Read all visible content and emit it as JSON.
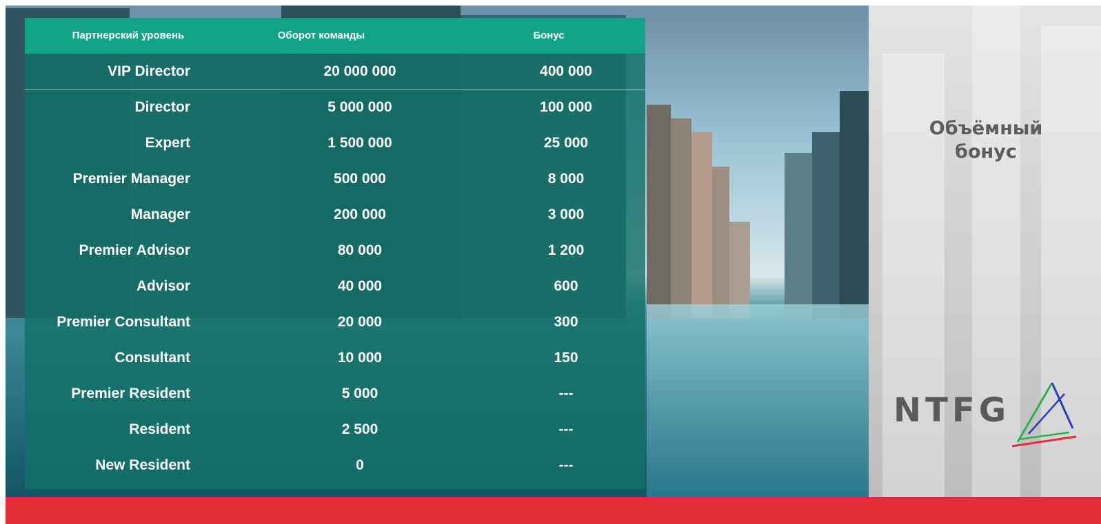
{
  "table": {
    "headers": [
      "Партнерский уровень",
      "Оборот команды",
      "Бонус"
    ],
    "rows": [
      {
        "level": "VIP Director",
        "turnover": "20 000 000",
        "bonus": "400 000"
      },
      {
        "level": "Director",
        "turnover": "5 000 000",
        "bonus": "100 000"
      },
      {
        "level": "Expert",
        "turnover": "1 500 000",
        "bonus": "25 000"
      },
      {
        "level": "Premier Manager",
        "turnover": "500 000",
        "bonus": "8 000"
      },
      {
        "level": "Manager",
        "turnover": "200 000",
        "bonus": "3 000"
      },
      {
        "level": "Premier Advisor",
        "turnover": "80 000",
        "bonus": "1 200"
      },
      {
        "level": "Advisor",
        "turnover": "40 000",
        "bonus": "600"
      },
      {
        "level": "Premier Consultant",
        "turnover": "20 000",
        "bonus": "300"
      },
      {
        "level": "Consultant",
        "turnover": "10 000",
        "bonus": "150"
      },
      {
        "level": "Premier Resident",
        "turnover": "5 000",
        "bonus": "---"
      },
      {
        "level": "Resident",
        "turnover": "2 500",
        "bonus": "---"
      },
      {
        "level": "New Resident",
        "turnover": "0",
        "bonus": "---"
      }
    ]
  },
  "side": {
    "title": "Объёмный\nбонус"
  },
  "logo": {
    "text": "NTFG"
  },
  "colors": {
    "header_bg": "#12a386",
    "table_bg": "#127066",
    "footer_bg": "#e52d3a",
    "logo_text": "#5a5a5a",
    "logo_green": "#2cb34a",
    "logo_red": "#e52d3a",
    "logo_blue": "#2a3cc0"
  }
}
